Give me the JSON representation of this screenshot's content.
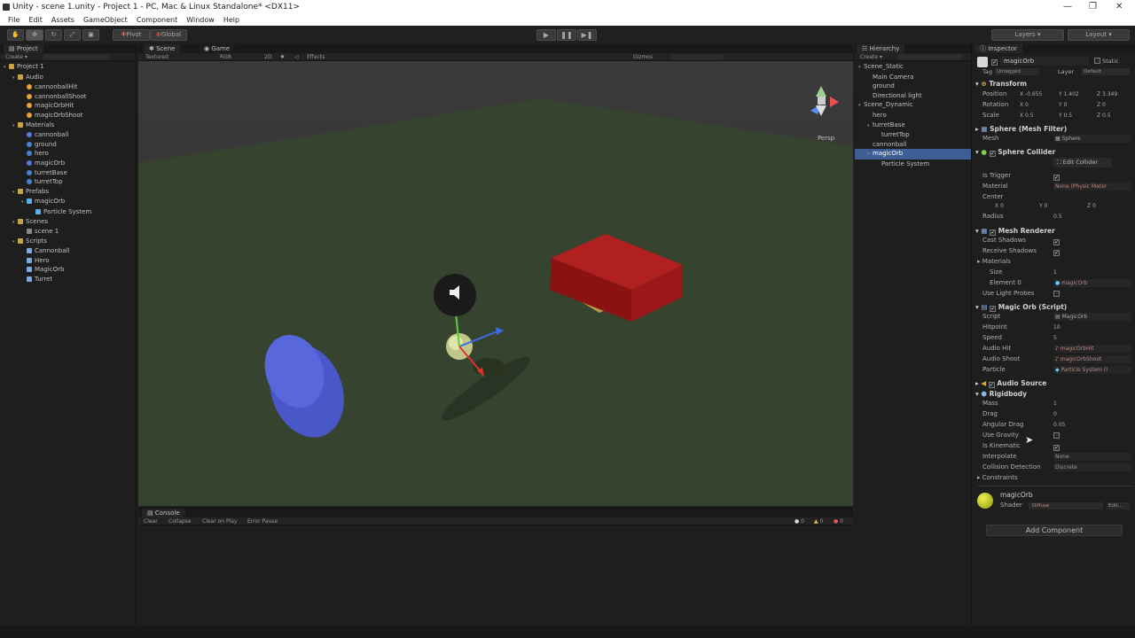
{
  "window": {
    "title": "Unity - scene 1.unity - Project 1 - PC, Mac & Linux Standalone* <DX11>"
  },
  "menu": [
    "File",
    "Edit",
    "Assets",
    "GameObject",
    "Component",
    "Window",
    "Help"
  ],
  "toolbar": {
    "pivot": "Pivot",
    "global": "Global",
    "layers": "Layers",
    "layout": "Layout"
  },
  "project": {
    "tab": "Project",
    "create": "Create ▾",
    "items": [
      {
        "label": "Project 1",
        "depth": 0,
        "type": "root"
      },
      {
        "label": "Audio",
        "depth": 1,
        "type": "folder"
      },
      {
        "label": "cannonballHit",
        "depth": 2,
        "type": "audio"
      },
      {
        "label": "cannonballShoot",
        "depth": 2,
        "type": "audio"
      },
      {
        "label": "magicOrbHit",
        "depth": 2,
        "type": "audio"
      },
      {
        "label": "magicOrbShoot",
        "depth": 2,
        "type": "audio"
      },
      {
        "label": "Materials",
        "depth": 1,
        "type": "folder"
      },
      {
        "label": "cannonball",
        "depth": 2,
        "type": "mat"
      },
      {
        "label": "ground",
        "depth": 2,
        "type": "mat"
      },
      {
        "label": "hero",
        "depth": 2,
        "type": "mat"
      },
      {
        "label": "magicOrb",
        "depth": 2,
        "type": "mat"
      },
      {
        "label": "turretBase",
        "depth": 2,
        "type": "mat"
      },
      {
        "label": "turretTop",
        "depth": 2,
        "type": "mat"
      },
      {
        "label": "Prefabs",
        "depth": 1,
        "type": "folder"
      },
      {
        "label": "magicOrb",
        "depth": 2,
        "type": "prefab"
      },
      {
        "label": "Particle System",
        "depth": 3,
        "type": "prefab"
      },
      {
        "label": "Scenes",
        "depth": 1,
        "type": "folder"
      },
      {
        "label": "scene 1",
        "depth": 2,
        "type": "scene"
      },
      {
        "label": "Scripts",
        "depth": 1,
        "type": "folder"
      },
      {
        "label": "Cannonball",
        "depth": 2,
        "type": "script"
      },
      {
        "label": "Hero",
        "depth": 2,
        "type": "script"
      },
      {
        "label": "MagicOrb",
        "depth": 2,
        "type": "script"
      },
      {
        "label": "Turret",
        "depth": 2,
        "type": "script"
      }
    ]
  },
  "scene": {
    "tab_scene": "Scene",
    "tab_game": "Game",
    "shading": "Textured",
    "rgb": "RGB",
    "mode2d": "2D",
    "effects": "Effects",
    "gizmos": "Gizmos",
    "persp": "Persp"
  },
  "console": {
    "tab": "Console",
    "buttons": [
      "Clear",
      "Collapse",
      "Clear on Play",
      "Error Pause"
    ],
    "counts": [
      "0",
      "0",
      "0"
    ]
  },
  "hierarchy": {
    "tab": "Hierarchy",
    "create": "Create ▾",
    "items": [
      {
        "label": "Scene_Static",
        "depth": 0
      },
      {
        "label": "Main Camera",
        "depth": 1
      },
      {
        "label": "ground",
        "depth": 1
      },
      {
        "label": "Directional light",
        "depth": 1
      },
      {
        "label": "Scene_Dynamic",
        "depth": 0
      },
      {
        "label": "hero",
        "depth": 1
      },
      {
        "label": "turretBase",
        "depth": 1
      },
      {
        "label": "turretTop",
        "depth": 2
      },
      {
        "label": "cannonball",
        "depth": 1
      },
      {
        "label": "magicOrb",
        "depth": 1,
        "selected": true
      },
      {
        "label": "Particle System",
        "depth": 2
      }
    ]
  },
  "inspector": {
    "tab": "Inspector",
    "name": "magicOrb",
    "static": "Static",
    "tag_label": "Tag",
    "tag": "Untagged",
    "layer_label": "Layer",
    "layer": "Default",
    "transform": {
      "title": "Transform",
      "position": "Position",
      "rotation": "Rotation",
      "scale": "Scale",
      "pos": [
        "X -0.655",
        "Y 1.402",
        "Z 3.349"
      ],
      "rot": [
        "X 0",
        "Y 0",
        "Z 0"
      ],
      "scl": [
        "X 0.5",
        "Y 0.5",
        "Z 0.5"
      ]
    },
    "mesh_filter": {
      "title": "Sphere (Mesh Filter)",
      "mesh_label": "Mesh",
      "mesh": "Sphere"
    },
    "sphere_collider": {
      "title": "Sphere Collider",
      "edit": "Edit Collider",
      "is_trigger": "Is Trigger",
      "material": "Material",
      "material_val": "None (Physic Mater",
      "center": "Center",
      "cx": "X 0",
      "cy": "Y 0",
      "cz": "Z 0",
      "radius": "Radius",
      "radius_val": "0.5"
    },
    "mesh_renderer": {
      "title": "Mesh Renderer",
      "cast": "Cast Shadows",
      "receive": "Receive Shadows",
      "materials": "Materials",
      "size": "Size",
      "size_val": "1",
      "element": "Element 0",
      "element_val": "magicOrb",
      "light_probes": "Use Light Probes"
    },
    "script": {
      "title": "Magic Orb (Script)",
      "script": "Script",
      "script_val": "MagicOrb",
      "hitpoint": "Hitpoint",
      "hitpoint_val": "10",
      "speed": "Speed",
      "speed_val": "5",
      "audio_hit": "Audio Hit",
      "audio_hit_val": "magicOrbHit",
      "audio_shoot": "Audio Shoot",
      "audio_shoot_val": "magicOrbShoot",
      "particle": "Particle",
      "particle_val": "Particle System (I"
    },
    "audio_source": {
      "title": "Audio Source"
    },
    "rigidbody": {
      "title": "Rigidbody",
      "mass": "Mass",
      "mass_val": "1",
      "drag": "Drag",
      "drag_val": "0",
      "angular": "Angular Drag",
      "angular_val": "0.05",
      "gravity": "Use Gravity",
      "kinematic": "Is Kinematic",
      "interpolate": "Interpolate",
      "interpolate_val": "None",
      "collision": "Collision Detection",
      "collision_val": "Discrete",
      "constraints": "Constraints"
    },
    "material": {
      "name": "magicOrb",
      "shader_label": "Shader",
      "shader": "Diffuse",
      "edit": "Edit..."
    },
    "add_component": "Add Component"
  }
}
